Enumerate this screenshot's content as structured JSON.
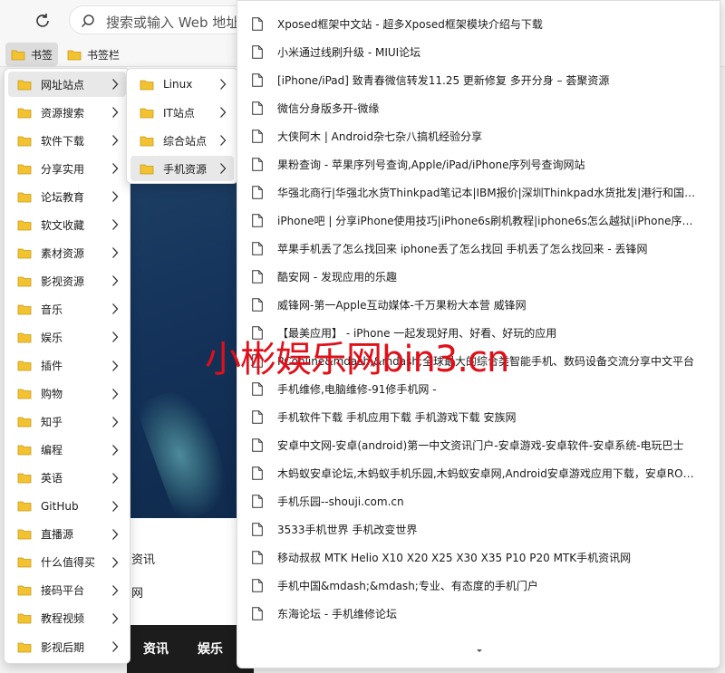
{
  "address_bar": {
    "placeholder": "搜索或输入 Web 地址"
  },
  "bookmark_bar": {
    "items": [
      "书签",
      "书签栏"
    ]
  },
  "page_behind": {
    "text1": "资讯",
    "text2": "网",
    "nav1": "资讯",
    "nav2": "娱乐"
  },
  "menu_level1": [
    "网址站点",
    "资源搜索",
    "软件下载",
    "分享实用",
    "论坛教育",
    "软文收藏",
    "素材资源",
    "影视资源",
    "音乐",
    "娱乐",
    "插件",
    "购物",
    "知乎",
    "编程",
    "英语",
    "GitHub",
    "直播源",
    "什么值得买",
    "接码平台",
    "教程视频",
    "影视后期"
  ],
  "menu_level2": [
    "Linux",
    "IT站点",
    "综合站点",
    "手机资源"
  ],
  "menu_level3": [
    "Xposed框架中文站 - 超多Xposed框架模块介绍与下载",
    "小米通过线刷升级 - MIUI论坛",
    "[iPhone/iPad] 致青春微信转发11.25 更新修复 多开分身 – 荟聚资源",
    "微信分身版多开-微缘",
    "大侠阿木 | Android杂七杂八搞机经验分享",
    "果粉查询 - 苹果序列号查询,Apple/iPad/iPhone序列号查询网站",
    "华强北商行|华强北水货Thinkpad笔记本|IBM报价|深圳Thinkpad水货批发|港行和国行…",
    "iPhone吧 | 分享iPhone使用技巧|iPhone6s刷机教程|iphone6s怎么越狱|iPhone序列…",
    "苹果手机丢了怎么找回来 iphone丢了怎么找回 手机丢了怎么找回来 - 丢锋网",
    "酷安网 - 发现应用的乐趣",
    "威锋网-第一Apple互动媒体-千万果粉大本营 威锋网",
    "【最美应用】 - iPhone 一起发现好用、好看、好玩的应用",
    "PConline&mdash;&mdash;全球最大的综合类智能手机、数码设备交流分享中文平台",
    "手机维修,电脑维修-91修手机网 -",
    "手机软件下载 手机应用下载 手机游戏下载 安族网",
    "安卓中文网-安卓(android)第一中文资讯门户-安卓游戏-安卓软件-安卓系统-电玩巴士",
    "木蚂蚁安卓论坛,木蚂蚁手机乐园,木蚂蚁安卓网,Android安卓游戏应用下载，安卓ROM…",
    "手机乐园--shouji.com.cn",
    "3533手机世界 手机改变世界",
    "移动叔叔 MTK Helio X10 X20 X25 X30 X35 P10 P20 MTK手机资讯网",
    "手机中国&mdash;&mdash;专业、有态度的手机门户",
    "东海论坛 - 手机维修论坛"
  ],
  "watermark": "小彬娱乐网bin3.cn",
  "colors": {
    "folder": "#f2c230",
    "watermark": "#e0101a",
    "highlight": "#e8e8e8"
  }
}
